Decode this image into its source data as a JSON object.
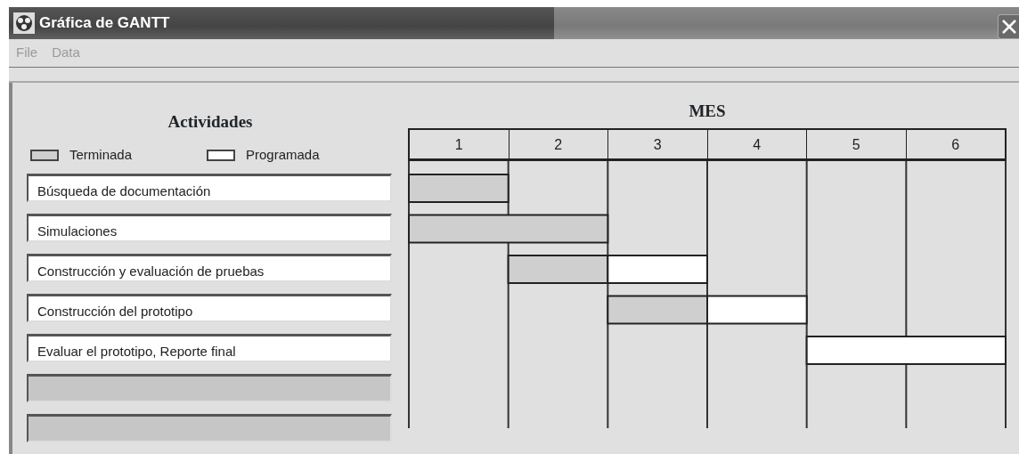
{
  "window": {
    "title": "Gráfica de GANTT"
  },
  "menu": [
    {
      "label": "File",
      "disabled": true
    },
    {
      "label": "Data",
      "disabled": true
    }
  ],
  "activities": {
    "title": "Actividades",
    "legend": [
      {
        "kind": "done",
        "label": "Terminada"
      },
      {
        "kind": "planned",
        "label": "Programada"
      }
    ],
    "fields": [
      {
        "value": "Búsqueda de documentación",
        "disabled": false
      },
      {
        "value": "Simulaciones",
        "disabled": false
      },
      {
        "value": "Construcción y evaluación de pruebas",
        "disabled": false
      },
      {
        "value": "Construcción del prototipo",
        "disabled": false
      },
      {
        "value": "Evaluar el prototipo, Reporte final",
        "disabled": false
      },
      {
        "disabled": true
      },
      {
        "disabled": true
      }
    ]
  },
  "gantt": {
    "title": "MES",
    "months": [
      "1",
      "2",
      "3",
      "4",
      "5",
      "6"
    ],
    "rows": [
      {
        "cells": [
          {
            "kind": "done"
          },
          {
            "kind": "none"
          },
          {
            "kind": "none"
          },
          {
            "kind": "none"
          },
          {
            "kind": "none"
          },
          {
            "kind": "none"
          }
        ]
      },
      {
        "cells": [
          {
            "kind": "done"
          },
          {
            "kind": "done"
          },
          {
            "kind": "none"
          },
          {
            "kind": "none"
          },
          {
            "kind": "none"
          },
          {
            "kind": "none"
          }
        ]
      },
      {
        "cells": [
          {
            "kind": "none"
          },
          {
            "kind": "done"
          },
          {
            "kind": "planned"
          },
          {
            "kind": "none"
          },
          {
            "kind": "none"
          },
          {
            "kind": "none"
          }
        ]
      },
      {
        "cells": [
          {
            "kind": "none"
          },
          {
            "kind": "none"
          },
          {
            "kind": "done"
          },
          {
            "kind": "planned"
          },
          {
            "kind": "none"
          },
          {
            "kind": "none"
          }
        ]
      },
      {
        "cells": [
          {
            "kind": "none"
          },
          {
            "kind": "none"
          },
          {
            "kind": "none"
          },
          {
            "kind": "none"
          },
          {
            "kind": "planned"
          },
          {
            "kind": "planned"
          }
        ]
      }
    ]
  }
}
